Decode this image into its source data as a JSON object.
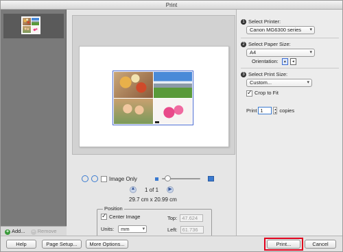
{
  "window": {
    "title": "Print"
  },
  "thumbnails": {
    "add_label": "Add...",
    "remove_label": "Remove"
  },
  "preview": {
    "image_only_label": "Image Only",
    "page_indicator": "1 of 1",
    "paper_dimensions": "29.7 cm x 20.99 cm",
    "prev_icon": "arrow-up-icon",
    "next_icon": "arrow-right-icon"
  },
  "position": {
    "legend": "Position",
    "center_image_label": "Center Image",
    "center_image_checked": true,
    "units_label": "Units:",
    "units_value": "mm",
    "top_label": "Top:",
    "top_value": "47.624",
    "left_label": "Left:",
    "left_value": "61.736"
  },
  "settings": {
    "printer": {
      "step": "1",
      "label": "Select Printer:",
      "value": "Canon MG6300 series"
    },
    "paper": {
      "step": "2",
      "label": "Select Paper Size:",
      "value": "A4",
      "orientation_label": "Orientation:"
    },
    "print_size": {
      "step": "3",
      "label": "Select Print Size:",
      "value": "Custom...",
      "crop_label": "Crop to Fit",
      "crop_checked": true
    },
    "copies": {
      "prefix": "Print",
      "value": "1",
      "suffix": "copies"
    }
  },
  "buttons": {
    "help": "Help",
    "page_setup": "Page Setup...",
    "more_options": "More Options...",
    "print": "Print...",
    "cancel": "Cancel"
  },
  "colors": {
    "accent": "#3a7ad0",
    "highlight": "#e0001b"
  }
}
